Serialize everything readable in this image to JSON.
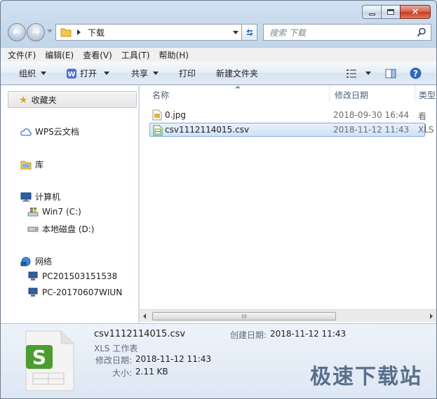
{
  "address": {
    "crumb": "下载"
  },
  "search": {
    "placeholder": "搜索 下载"
  },
  "menubar": {
    "items": [
      "文件(F)",
      "编辑(E)",
      "查看(V)",
      "工具(T)",
      "帮助(H)"
    ]
  },
  "toolbar": {
    "organize": "组织",
    "open": "打开",
    "share": "共享",
    "print": "打印",
    "new_folder": "新建文件夹"
  },
  "nav": {
    "favorites": "收藏夹",
    "wps_cloud": "WPS云文档",
    "libraries": "库",
    "computer": "计算机",
    "drive_c": "Win7 (C:)",
    "drive_d": "本地磁盘 (D:)",
    "network": "网络",
    "pc1": "PC201503151538",
    "pc2": "PC-20170607WIUN"
  },
  "columns": {
    "name": "名称",
    "modified": "修改日期",
    "type": "类型"
  },
  "files": [
    {
      "name": "0.jpg",
      "modified": "2018-09-30 16:44",
      "type": "看图"
    },
    {
      "name": "csv1112114015.csv",
      "modified": "2018-11-12 11:43",
      "type": "XLS"
    }
  ],
  "scrollbar": {
    "grip": "III"
  },
  "details": {
    "file_name": "csv1112114015.csv",
    "file_type": "XLS 工作表",
    "modified_label": "修改日期:",
    "modified_value": "2018-11-12 11:43",
    "size_label": "大小:",
    "size_value": "2.11 KB",
    "created_label": "创建日期:",
    "created_value": "2018-11-12 11:43"
  },
  "watermark": "极速下载站",
  "colors": {
    "accent": "#4c9d2f",
    "selection": "#cfe2f7"
  }
}
